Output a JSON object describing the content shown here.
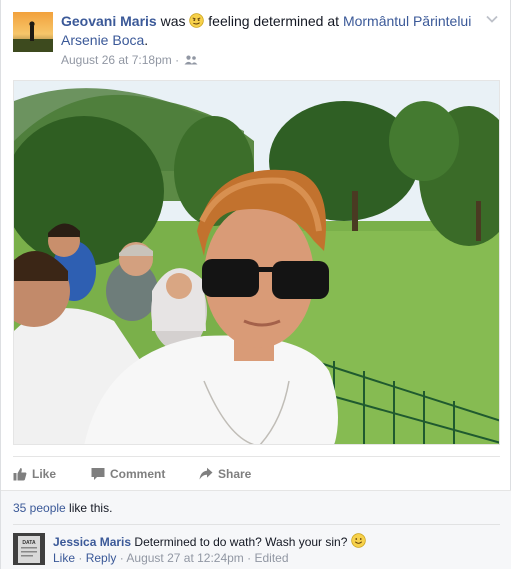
{
  "post": {
    "author": "Geovani Maris",
    "was": "was",
    "feeling": "feeling determined at",
    "place": "Mormântul Părintelui Arsenie Boca",
    "period": ".",
    "timestamp": "August 26 at 7:18pm",
    "separator": "·",
    "audience_icon": "friends-icon",
    "menu_icon": "chevron-down-icon",
    "feeling_icon": "determined-emoji-icon"
  },
  "actions": {
    "like": "Like",
    "comment": "Comment",
    "share": "Share"
  },
  "likes": {
    "count_link": "35 people",
    "suffix": " like this."
  },
  "comment": {
    "author": "Jessica Maris",
    "text": "Determined to do wath? Wash your sin?",
    "like": "Like",
    "reply": "Reply",
    "timestamp": "August 27 at 12:24pm",
    "edited": "Edited",
    "dot": " · ",
    "avatar_label": "DATA"
  },
  "colors": {
    "link": "#3b5998",
    "muted": "#9197a3",
    "action": "#7f7f7f",
    "feedback_bg": "#f6f7f9"
  }
}
